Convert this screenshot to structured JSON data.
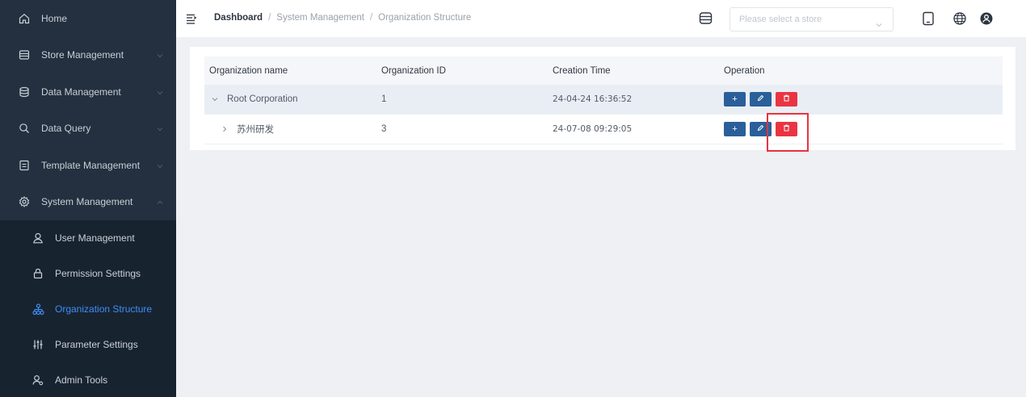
{
  "sidebar": {
    "items": [
      {
        "label": "Home",
        "icon": "home-icon"
      },
      {
        "label": "Store Management",
        "icon": "store-icon"
      },
      {
        "label": "Data Management",
        "icon": "database-icon"
      },
      {
        "label": "Data Query",
        "icon": "search-icon"
      },
      {
        "label": "Template Management",
        "icon": "template-icon"
      },
      {
        "label": "System Management",
        "icon": "gear-icon"
      }
    ],
    "sub_items": [
      {
        "label": "User Management",
        "icon": "user-icon"
      },
      {
        "label": "Permission Settings",
        "icon": "lock-icon"
      },
      {
        "label": "Organization Structure",
        "icon": "org-chart-icon"
      },
      {
        "label": "Parameter Settings",
        "icon": "sliders-icon"
      },
      {
        "label": "Admin Tools",
        "icon": "admin-icon"
      }
    ],
    "active_sub": "Organization Structure"
  },
  "header": {
    "breadcrumb": [
      "Dashboard",
      "System Management",
      "Organization Structure"
    ],
    "breadcrumb_sep": "/",
    "store_placeholder": "Please select a store"
  },
  "table": {
    "columns": [
      "Organization name",
      "Organization ID",
      "Creation Time",
      "Operation"
    ],
    "rows": [
      {
        "name": "Root Corporation",
        "id": "1",
        "created": "24-04-24 16:36:52",
        "expanded": true
      },
      {
        "name": "苏州研发",
        "id": "3",
        "created": "24-07-08 09:29:05",
        "expanded": false
      }
    ],
    "actions": {
      "add": "+",
      "edit": "edit-icon",
      "delete": "trash-icon"
    }
  },
  "colors": {
    "sidebar_bg": "#24303f",
    "submenu_bg": "#182330",
    "active": "#3d8ef5",
    "btn_blue": "#2a5f9a",
    "btn_red": "#ea3442",
    "highlight": "#e8333e"
  }
}
